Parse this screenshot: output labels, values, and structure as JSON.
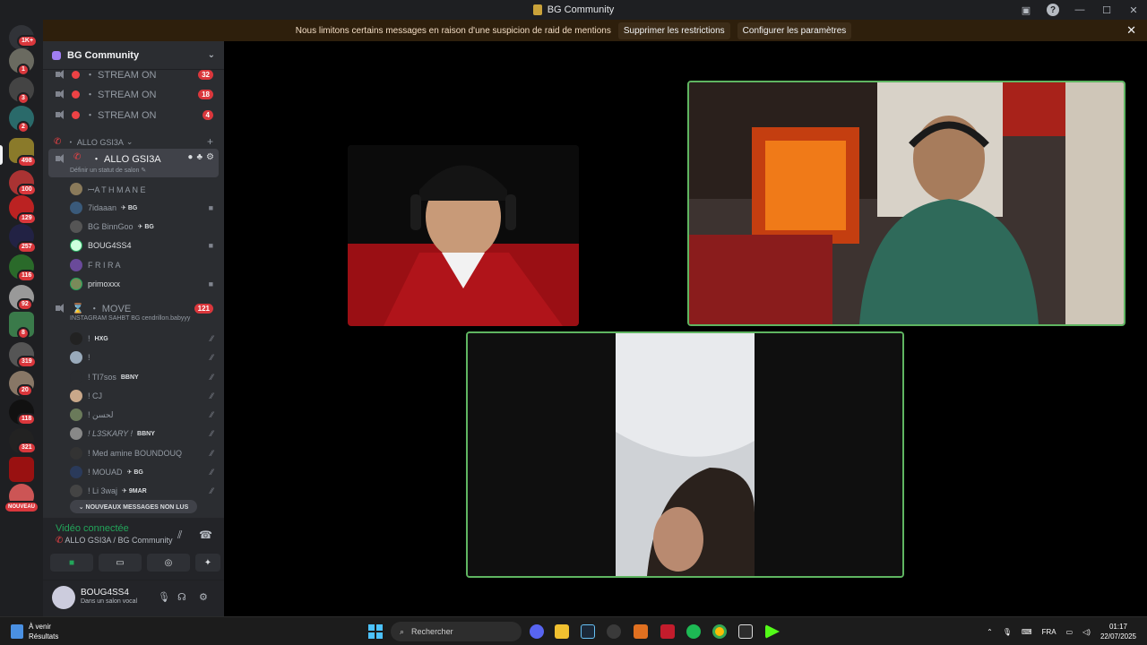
{
  "window": {
    "title": "BG Community"
  },
  "banner": {
    "text": "Nous limitons certains messages en raison d'une suspicion de raid de mentions",
    "remove_btn": "Supprimer les restrictions",
    "config_btn": "Configurer les paramètres"
  },
  "rail": {
    "badges": [
      "1K+",
      "1",
      "3",
      "2",
      "498",
      "100",
      "129",
      "257",
      "116",
      "92",
      "8",
      "319",
      "20",
      "118",
      "321",
      "NOUVEAU"
    ]
  },
  "server": {
    "name": "BG Community"
  },
  "channels": {
    "stream": [
      {
        "label": "・ STREAM ON",
        "count": "32"
      },
      {
        "label": "・ STREAM ON",
        "count": "18"
      },
      {
        "label": "・ STREAM ON",
        "count": "4"
      }
    ],
    "category": "・ ALLO GSI3A",
    "active": {
      "label": "・ ALLO GSI3A",
      "status": "Définir un statut de salon ✎"
    },
    "move": {
      "label": "・ MOVE",
      "count": "121",
      "status": "INSTAGRAM SAHBT BG cendrillon.babyyy"
    }
  },
  "members_allo": [
    {
      "name": "ꟷA T H M A N E",
      "tag": ""
    },
    {
      "name": "7idaaan",
      "tag": "✈ BG"
    },
    {
      "name": "BG BinnGoo",
      "tag": "✈ BG"
    },
    {
      "name": "BOUG4SS4",
      "tag": ""
    },
    {
      "name": "F R I R A",
      "tag": ""
    },
    {
      "name": "primoxxx",
      "tag": ""
    }
  ],
  "members_move": [
    {
      "name": "!",
      "tag": "HXG"
    },
    {
      "name": "!",
      "tag": ""
    },
    {
      "name": "! TI7sos",
      "tag": "BBNY"
    },
    {
      "name": "! CJ",
      "tag": ""
    },
    {
      "name": "! لحسن",
      "tag": ""
    },
    {
      "name": "! L3SKARY ! ",
      "tag": "BBNY"
    },
    {
      "name": "! Med amine BOUNDOUQ",
      "tag": ""
    },
    {
      "name": "! MOUAD",
      "tag": "✈ BG"
    },
    {
      "name": "! Li 3waj",
      "tag": "✈ 9MAR"
    }
  ],
  "unread_pill": "⌄ NOUVEAUX MESSAGES NON LUS",
  "voice": {
    "connected": "Vidéo connectée",
    "location": "ALLO GSI3A / BG Community"
  },
  "user": {
    "name": "BOUG4SS4",
    "status": "Dans un salon vocal"
  },
  "taskbar": {
    "weather_title": "À venir",
    "weather_sub": "Résultats",
    "search_placeholder": "Rechercher",
    "lang": "FRA",
    "time": "01:17",
    "date": "22/07/2025"
  },
  "colors": {
    "speaking_border": "#5fb561",
    "badge_red": "#da373c",
    "connected_green": "#23a55a"
  }
}
